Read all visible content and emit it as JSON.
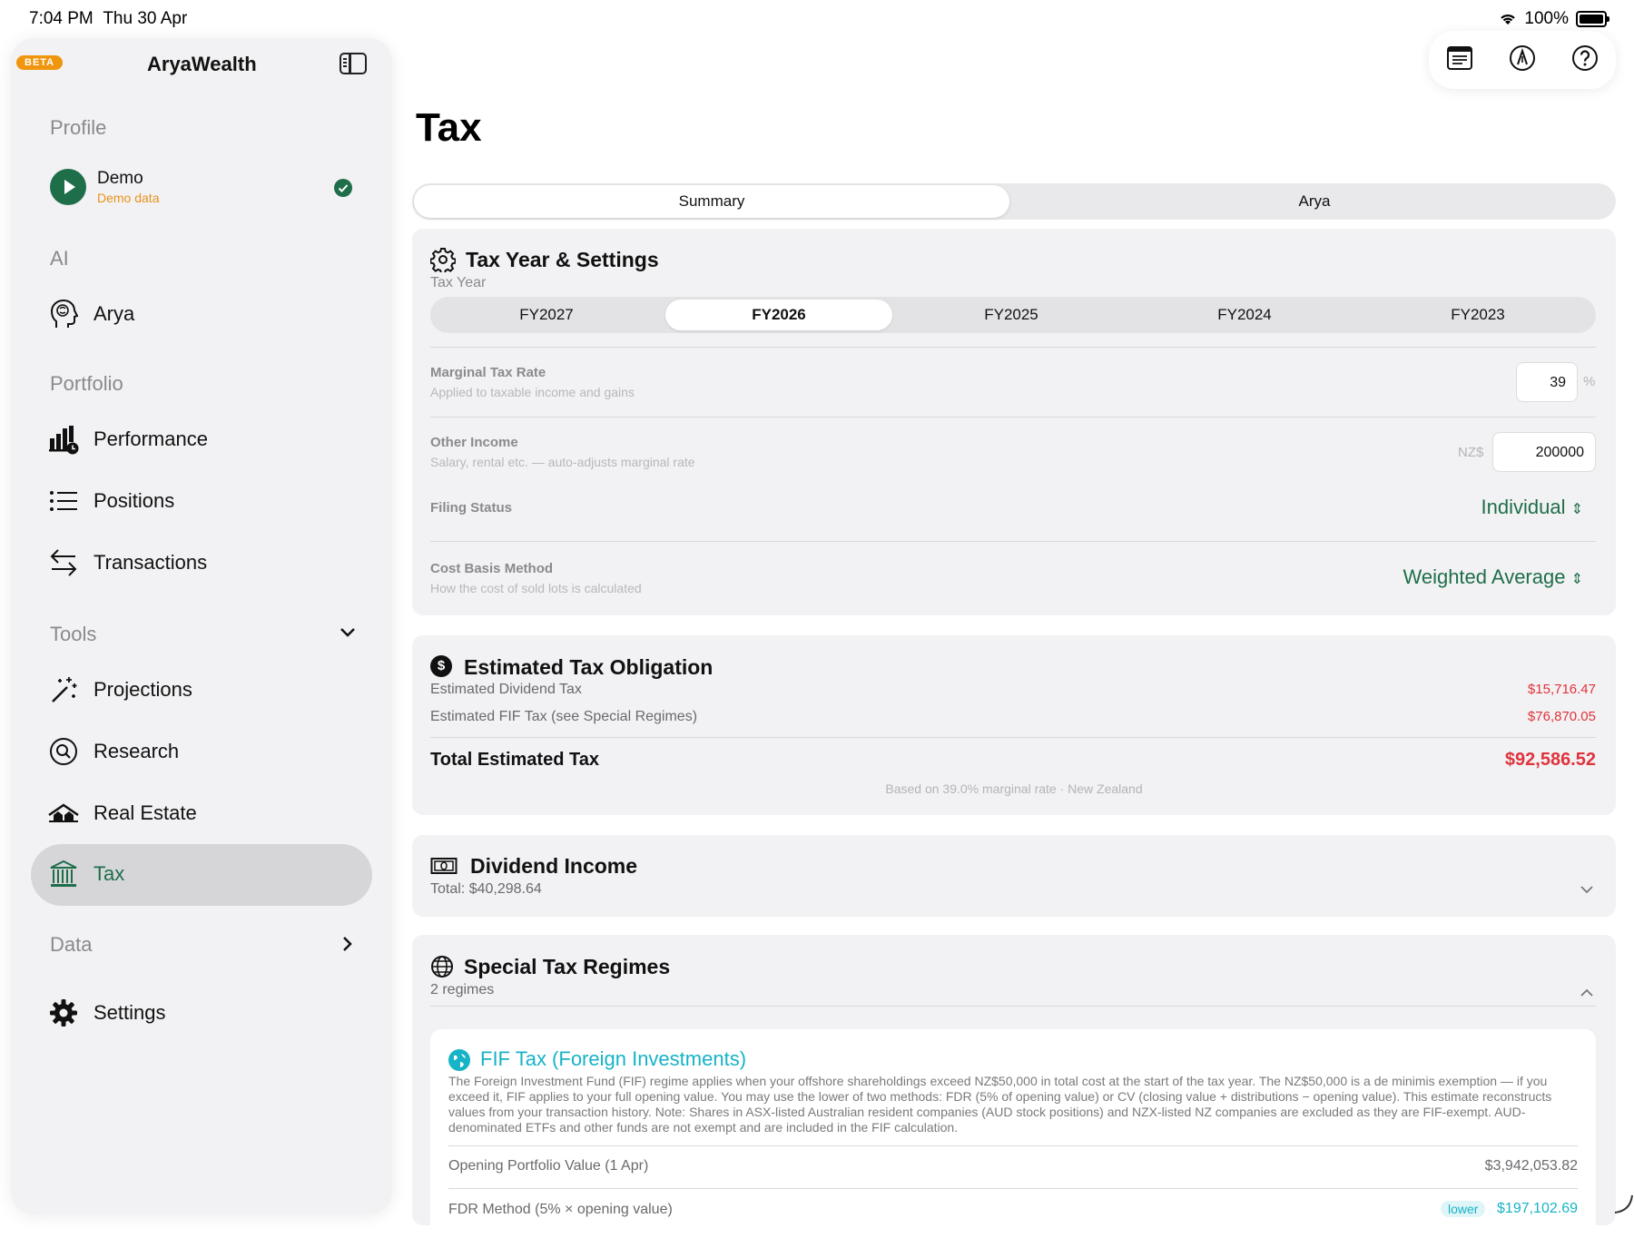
{
  "status": {
    "time": "7:04 PM",
    "date": "Thu 30 Apr",
    "battery": "100%"
  },
  "sidebar": {
    "beta": "BETA",
    "app_title": "AryaWealth",
    "profile_label": "Profile",
    "profile_name": "Demo",
    "profile_sub": "Demo data",
    "ai_label": "AI",
    "arya": "Arya",
    "portfolio_label": "Portfolio",
    "performance": "Performance",
    "positions": "Positions",
    "transactions": "Transactions",
    "tools_label": "Tools",
    "projections": "Projections",
    "research": "Research",
    "real_estate": "Real Estate",
    "tax": "Tax",
    "data_label": "Data",
    "settings": "Settings"
  },
  "page": {
    "title": "Tax"
  },
  "tabs": [
    "Summary",
    "Arya"
  ],
  "settings_card": {
    "title": "Tax Year & Settings",
    "tax_year_label": "Tax Year",
    "years": [
      "FY2027",
      "FY2026",
      "FY2025",
      "FY2024",
      "FY2023"
    ],
    "selected_year": "FY2026",
    "marginal_label": "Marginal Tax Rate",
    "marginal_sub": "Applied to taxable income and gains",
    "marginal_value": "39",
    "percent": "%",
    "other_income_label": "Other Income",
    "other_income_sub": "Salary, rental etc. — auto-adjusts marginal rate",
    "currency": "NZ$",
    "other_income_value": "200000",
    "filing_label": "Filing Status",
    "filing_value": "Individual",
    "cost_basis_label": "Cost Basis Method",
    "cost_basis_sub": "How the cost of sold lots is calculated",
    "cost_basis_value": "Weighted Average"
  },
  "obligation_card": {
    "title": "Estimated Tax Obligation",
    "dividend_label": "Estimated Dividend Tax",
    "dividend_value": "$15,716.47",
    "fif_label": "Estimated FIF Tax (see Special Regimes)",
    "fif_value": "$76,870.05",
    "total_label": "Total Estimated Tax",
    "total_value": "$92,586.52",
    "footnote": "Based on 39.0% marginal rate · New Zealand"
  },
  "dividend_card": {
    "title": "Dividend Income",
    "total": "Total: $40,298.64"
  },
  "regimes_card": {
    "title": "Special Tax Regimes",
    "count": "2 regimes"
  },
  "fif_card": {
    "title": "FIF Tax (Foreign Investments)",
    "description": "The Foreign Investment Fund (FIF) regime applies when your offshore shareholdings exceed NZ$50,000 in total cost at the start of the tax year. The NZ$50,000 is a de minimis exemption — if you exceed it, FIF applies to your full opening value. You may use the lower of two methods: FDR (5% of opening value) or CV (closing value + distributions − opening value). This estimate reconstructs values from your transaction history. Note: Shares in ASX-listed Australian resident companies (AUD stock positions) and NZX-listed NZ companies are excluded as they are FIF-exempt. AUD-denominated ETFs and other funds are not exempt and are included in the FIF calculation.",
    "opening_label": "Opening Portfolio Value (1 Apr)",
    "opening_value": "$3,942,053.82",
    "fdr_label": "FDR Method (5% × opening value)",
    "fdr_badge": "lower",
    "fdr_value": "$197,102.69"
  },
  "colors": {
    "accent": "#1f6e4a",
    "red": "#e0333c",
    "teal": "#17b3c6",
    "beta": "#f0960e"
  }
}
